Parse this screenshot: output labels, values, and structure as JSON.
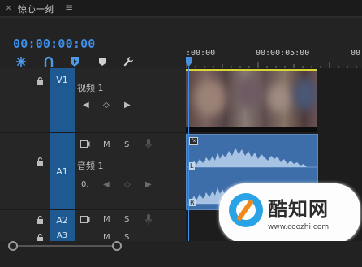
{
  "panel": {
    "close_label": "×",
    "title": "惊心一刻",
    "menu_label": "≡"
  },
  "timecode": "00:00:00:00",
  "toolbar": {
    "tools": [
      "snap-icon",
      "linked-selection-icon",
      "add-marker-icon",
      "marker-icon",
      "wrench-icon"
    ]
  },
  "ruler": {
    "labels": [
      ":00:00",
      "00:00:05:00",
      "00"
    ]
  },
  "tracks": {
    "v1": {
      "label": "V1",
      "name": "视频 1",
      "controls": {
        "prev": "◀",
        "keyframe": "◇",
        "next": "▶"
      }
    },
    "a1": {
      "label": "A1",
      "name": "音频 1",
      "m": "M",
      "s": "S",
      "volume": "0.",
      "controls": {
        "prev": "◀",
        "keyframe": "◇",
        "next": "▶"
      }
    },
    "a2": {
      "label": "A2",
      "m": "M",
      "s": "S"
    },
    "a3": {
      "label": "A3",
      "m": "M",
      "s": "S"
    }
  },
  "audio_clip": {
    "channel_left": "L",
    "channel_right": "R",
    "fx_badge": "fx"
  },
  "watermark": {
    "title": "酷知网",
    "url": "www.coozhi.com"
  },
  "colors": {
    "accent": "#3d8ee6",
    "track_target": "#1e5a91",
    "video_clip_border": "#d8d437",
    "audio_clip": "#3d6eaa"
  }
}
